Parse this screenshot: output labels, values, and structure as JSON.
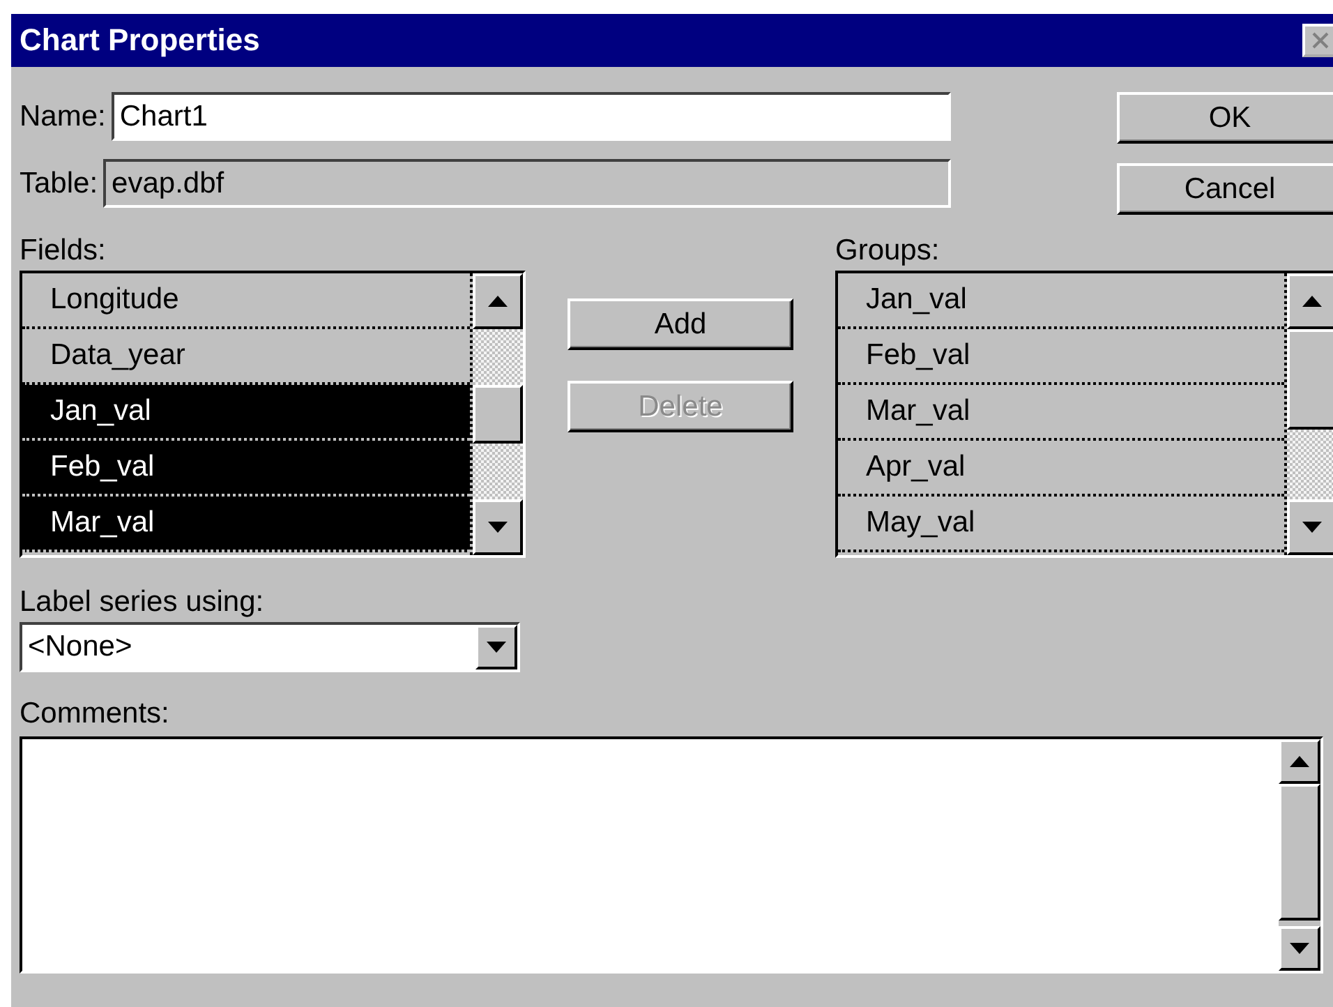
{
  "window": {
    "title": "Chart Properties"
  },
  "name_field": {
    "label": "Name:",
    "value": "Chart1"
  },
  "table_field": {
    "label": "Table:",
    "value": "evap.dbf",
    "disabled": true
  },
  "buttons": [
    {
      "label": "OK",
      "disabled": false
    },
    {
      "label": "Cancel",
      "disabled": false
    }
  ],
  "fields": {
    "label": "Fields:",
    "items": [
      {
        "label": "Longitude",
        "selected": false
      },
      {
        "label": "Data_year",
        "selected": false
      },
      {
        "label": "Jan_val",
        "selected": true
      },
      {
        "label": "Feb_val",
        "selected": true
      },
      {
        "label": "Mar_val",
        "selected": true
      }
    ]
  },
  "list_buttons": [
    {
      "label": "Add",
      "disabled": false
    },
    {
      "label": "Delete",
      "disabled": true
    }
  ],
  "groups": {
    "label": "Groups:",
    "items": [
      {
        "label": "Jan_val",
        "selected": false
      },
      {
        "label": "Feb_val",
        "selected": false
      },
      {
        "label": "Mar_val",
        "selected": false
      },
      {
        "label": "Apr_val",
        "selected": false
      },
      {
        "label": "May_val",
        "selected": false
      }
    ]
  },
  "label_series": {
    "label": "Label series using:",
    "value": "<None>"
  },
  "comments": {
    "label": "Comments:"
  }
}
